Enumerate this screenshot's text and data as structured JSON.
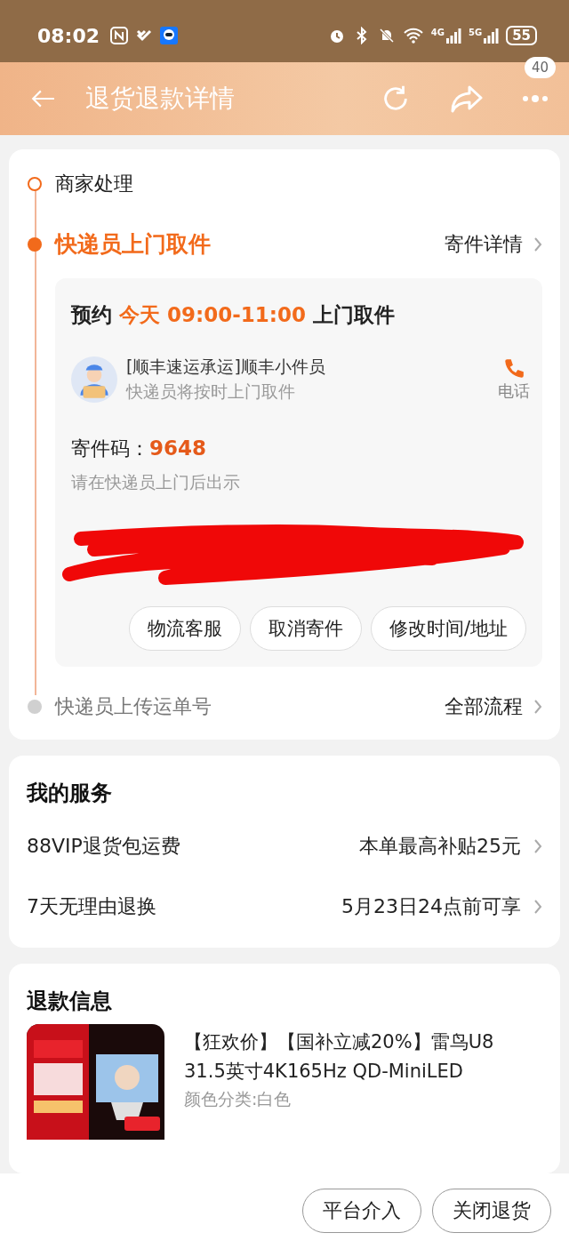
{
  "status_bar": {
    "time": "08:02",
    "network_1": "4G",
    "network_2": "5G",
    "battery": "55"
  },
  "header": {
    "title": "退货退款详情",
    "more_badge": "40"
  },
  "progress": {
    "steps": [
      {
        "label": "商家处理",
        "completed": true,
        "active": false
      },
      {
        "label": "快递员上门取件",
        "completed": false,
        "active": true,
        "link": "寄件详情"
      },
      {
        "label": "快递员上传运单号",
        "completed": false,
        "active": false,
        "link": "全部流程"
      }
    ],
    "pickup": {
      "prefix": "预约",
      "time": "今天 09:00-11:00",
      "suffix": "上门取件",
      "courier_name": "[顺丰速运承运]顺丰小件员",
      "courier_note": "快递员将按时上门取件",
      "call_label": "电话",
      "code_label": "寄件码：",
      "code": "9648",
      "code_hint": "请在快递员上门后出示",
      "redacted": true,
      "actions": [
        "物流客服",
        "取消寄件",
        "修改时间/地址"
      ]
    }
  },
  "services": {
    "title": "我的服务",
    "rows": [
      {
        "label": "88VIP退货包运费",
        "value": "本单最高补贴25元"
      },
      {
        "label": "7天无理由退换",
        "value": "5月23日24点前可享"
      }
    ]
  },
  "refund": {
    "title": "退款信息",
    "product": {
      "kind": "picture",
      "title": "【狂欢价】【国补立减20%】雷鸟U8 31.5英寸4K165Hz QD-MiniLED",
      "variant": "颜色分类:白色"
    }
  },
  "bottom_actions": [
    "平台介入",
    "关闭退货"
  ]
}
